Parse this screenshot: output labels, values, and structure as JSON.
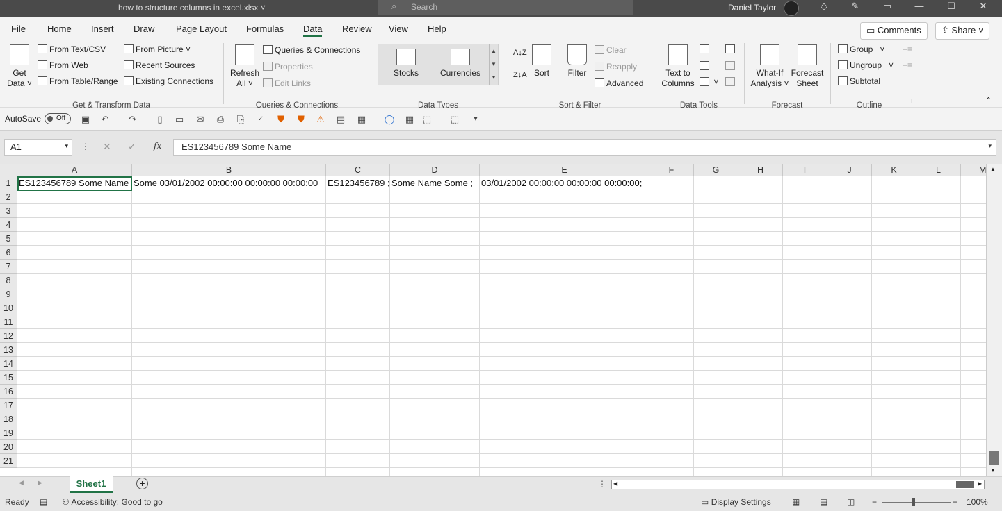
{
  "titlebar": {
    "filename": "how to structure columns in excel.xlsx",
    "search_placeholder": "Search",
    "user": "Daniel Taylor"
  },
  "tabs": [
    "File",
    "Home",
    "Insert",
    "Draw",
    "Page Layout",
    "Formulas",
    "Data",
    "Review",
    "View",
    "Help"
  ],
  "active_tab": "Data",
  "top_buttons": {
    "comments": "Comments",
    "share": "Share"
  },
  "ribbon": {
    "get_transform": {
      "get_data": [
        "Get",
        "Data"
      ],
      "from_text_csv": "From Text/CSV",
      "from_web": "From Web",
      "from_table_range": "From Table/Range",
      "from_picture": "From Picture",
      "recent_sources": "Recent Sources",
      "existing_connections": "Existing Connections",
      "label": "Get & Transform Data"
    },
    "queries": {
      "refresh_all": [
        "Refresh",
        "All"
      ],
      "queries_connections": "Queries & Connections",
      "properties": "Properties",
      "edit_links": "Edit Links",
      "label": "Queries & Connections"
    },
    "data_types": {
      "stocks": "Stocks",
      "currencies": "Currencies",
      "label": "Data Types"
    },
    "sort_filter": {
      "sort": "Sort",
      "filter": "Filter",
      "clear": "Clear",
      "reapply": "Reapply",
      "advanced": "Advanced",
      "label": "Sort & Filter"
    },
    "data_tools": {
      "text_to_columns": [
        "Text to",
        "Columns"
      ],
      "label": "Data Tools"
    },
    "forecast": {
      "what_if": [
        "What-If",
        "Analysis"
      ],
      "forecast_sheet": [
        "Forecast",
        "Sheet"
      ],
      "label": "Forecast"
    },
    "outline": {
      "group": "Group",
      "ungroup": "Ungroup",
      "subtotal": "Subtotal",
      "label": "Outline"
    }
  },
  "qat": {
    "autosave": "AutoSave",
    "toggle": "Off"
  },
  "formula_bar": {
    "name_box": "A1",
    "formula": "ES123456789 Some Name",
    "fx": "fx"
  },
  "columns": [
    "A",
    "B",
    "C",
    "D",
    "E",
    "F",
    "G",
    "H",
    "I",
    "J",
    "K",
    "L",
    "M"
  ],
  "rows": [
    "1",
    "2",
    "3",
    "4",
    "5",
    "6",
    "7",
    "8",
    "9",
    "10",
    "11",
    "12",
    "13",
    "14",
    "15",
    "16",
    "17",
    "18",
    "19",
    "20",
    "21"
  ],
  "cells": {
    "A1": "ES123456789 Some Name",
    "B1": "Some 03/01/2002 00:00:00 00:00:00 00:00:00",
    "C1": "ES123456789 ;",
    "D1": "Some Name Some ;",
    "E1": "03/01/2002 00:00:00 00:00:00 00:00:00;"
  },
  "sheet_tab": "Sheet1",
  "status": {
    "ready": "Ready",
    "accessibility": "Accessibility: Good to go",
    "display_settings": "Display Settings",
    "zoom": "100%"
  }
}
